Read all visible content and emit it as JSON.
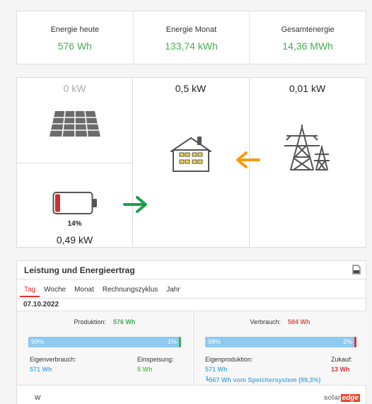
{
  "stats": [
    {
      "label": "Energie heute",
      "value": "576 Wh"
    },
    {
      "label": "Energie Monat",
      "value": "133,74 kWh"
    },
    {
      "label": "Gesamtenergie",
      "value": "14,36 MWh"
    }
  ],
  "flow": {
    "pv_power": "0 kW",
    "home_power": "0,5 kW",
    "grid_power": "0,01 kW",
    "battery_percent": "14%",
    "battery_level": 0.14,
    "battery_power": "0,49 kW"
  },
  "energy": {
    "title": "Leistung und Energieertrag",
    "tabs": [
      "Tag",
      "Woche",
      "Monat",
      "Rechnungszyklus",
      "Jahr"
    ],
    "active_tab": "Tag",
    "date": "07.10.2022",
    "production": {
      "label": "Produktion:",
      "value": "576 Wh",
      "bar_left": "99%",
      "bar_right": "1%",
      "self_label": "Eigenverbrauch:",
      "self_value": "571 Wh",
      "feed_label": "Einspeisung:",
      "feed_value": "5 Wh"
    },
    "consumption": {
      "label": "Verbrauch:",
      "value": "584 Wh",
      "bar_left": "98%",
      "bar_right": "2%",
      "self_label": "Eigenproduktion:",
      "self_value": "571 Wh",
      "buy_label": "Zukauf:",
      "buy_value": "13 Wh",
      "storage_note": "567 Wh vom Speichersystem (99,3%)"
    },
    "axis_unit": "W"
  },
  "brand": {
    "part1": "solar",
    "part2": "edge"
  },
  "colors": {
    "accent_green": "#45ad52",
    "accent_red": "#d33333",
    "bar_blue": "#8ec9f0",
    "arrow_orange": "#f39c12",
    "arrow_green": "#1aa14b"
  }
}
